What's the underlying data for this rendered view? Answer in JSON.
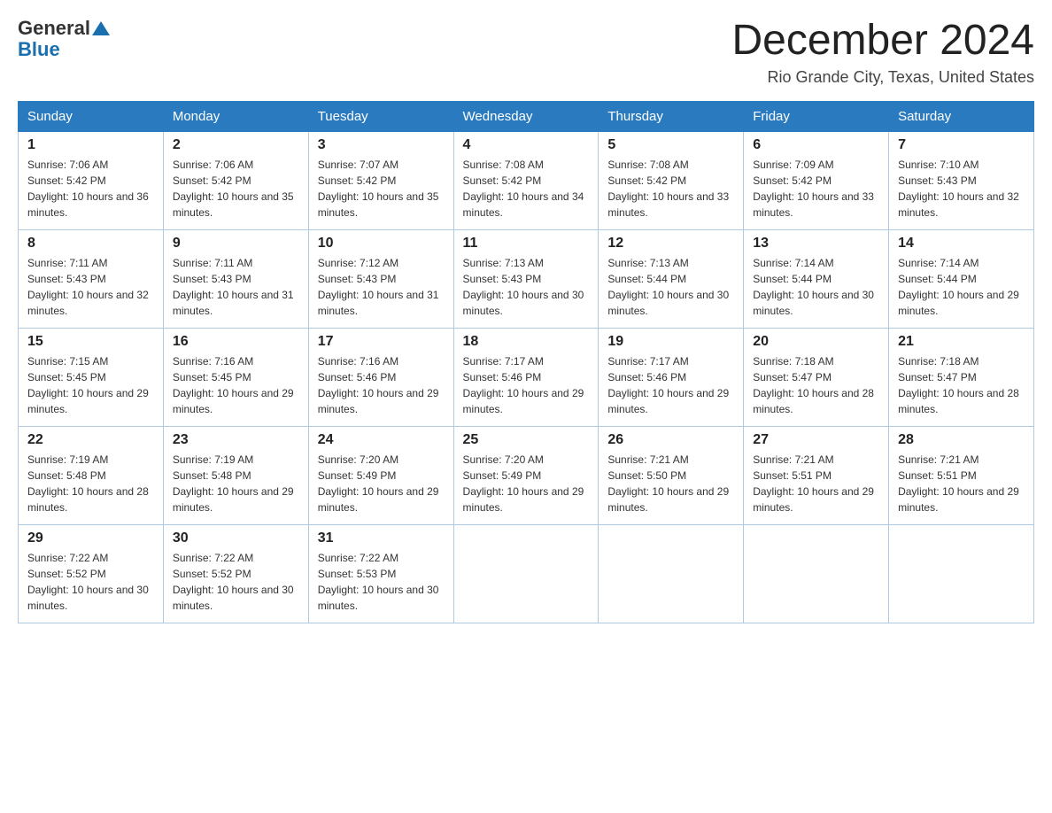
{
  "logo": {
    "general": "General",
    "blue": "Blue"
  },
  "title": "December 2024",
  "location": "Rio Grande City, Texas, United States",
  "headers": [
    "Sunday",
    "Monday",
    "Tuesday",
    "Wednesday",
    "Thursday",
    "Friday",
    "Saturday"
  ],
  "weeks": [
    [
      {
        "day": "1",
        "sunrise": "7:06 AM",
        "sunset": "5:42 PM",
        "daylight": "10 hours and 36 minutes."
      },
      {
        "day": "2",
        "sunrise": "7:06 AM",
        "sunset": "5:42 PM",
        "daylight": "10 hours and 35 minutes."
      },
      {
        "day": "3",
        "sunrise": "7:07 AM",
        "sunset": "5:42 PM",
        "daylight": "10 hours and 35 minutes."
      },
      {
        "day": "4",
        "sunrise": "7:08 AM",
        "sunset": "5:42 PM",
        "daylight": "10 hours and 34 minutes."
      },
      {
        "day": "5",
        "sunrise": "7:08 AM",
        "sunset": "5:42 PM",
        "daylight": "10 hours and 33 minutes."
      },
      {
        "day": "6",
        "sunrise": "7:09 AM",
        "sunset": "5:42 PM",
        "daylight": "10 hours and 33 minutes."
      },
      {
        "day": "7",
        "sunrise": "7:10 AM",
        "sunset": "5:43 PM",
        "daylight": "10 hours and 32 minutes."
      }
    ],
    [
      {
        "day": "8",
        "sunrise": "7:11 AM",
        "sunset": "5:43 PM",
        "daylight": "10 hours and 32 minutes."
      },
      {
        "day": "9",
        "sunrise": "7:11 AM",
        "sunset": "5:43 PM",
        "daylight": "10 hours and 31 minutes."
      },
      {
        "day": "10",
        "sunrise": "7:12 AM",
        "sunset": "5:43 PM",
        "daylight": "10 hours and 31 minutes."
      },
      {
        "day": "11",
        "sunrise": "7:13 AM",
        "sunset": "5:43 PM",
        "daylight": "10 hours and 30 minutes."
      },
      {
        "day": "12",
        "sunrise": "7:13 AM",
        "sunset": "5:44 PM",
        "daylight": "10 hours and 30 minutes."
      },
      {
        "day": "13",
        "sunrise": "7:14 AM",
        "sunset": "5:44 PM",
        "daylight": "10 hours and 30 minutes."
      },
      {
        "day": "14",
        "sunrise": "7:14 AM",
        "sunset": "5:44 PM",
        "daylight": "10 hours and 29 minutes."
      }
    ],
    [
      {
        "day": "15",
        "sunrise": "7:15 AM",
        "sunset": "5:45 PM",
        "daylight": "10 hours and 29 minutes."
      },
      {
        "day": "16",
        "sunrise": "7:16 AM",
        "sunset": "5:45 PM",
        "daylight": "10 hours and 29 minutes."
      },
      {
        "day": "17",
        "sunrise": "7:16 AM",
        "sunset": "5:46 PM",
        "daylight": "10 hours and 29 minutes."
      },
      {
        "day": "18",
        "sunrise": "7:17 AM",
        "sunset": "5:46 PM",
        "daylight": "10 hours and 29 minutes."
      },
      {
        "day": "19",
        "sunrise": "7:17 AM",
        "sunset": "5:46 PM",
        "daylight": "10 hours and 29 minutes."
      },
      {
        "day": "20",
        "sunrise": "7:18 AM",
        "sunset": "5:47 PM",
        "daylight": "10 hours and 28 minutes."
      },
      {
        "day": "21",
        "sunrise": "7:18 AM",
        "sunset": "5:47 PM",
        "daylight": "10 hours and 28 minutes."
      }
    ],
    [
      {
        "day": "22",
        "sunrise": "7:19 AM",
        "sunset": "5:48 PM",
        "daylight": "10 hours and 28 minutes."
      },
      {
        "day": "23",
        "sunrise": "7:19 AM",
        "sunset": "5:48 PM",
        "daylight": "10 hours and 29 minutes."
      },
      {
        "day": "24",
        "sunrise": "7:20 AM",
        "sunset": "5:49 PM",
        "daylight": "10 hours and 29 minutes."
      },
      {
        "day": "25",
        "sunrise": "7:20 AM",
        "sunset": "5:49 PM",
        "daylight": "10 hours and 29 minutes."
      },
      {
        "day": "26",
        "sunrise": "7:21 AM",
        "sunset": "5:50 PM",
        "daylight": "10 hours and 29 minutes."
      },
      {
        "day": "27",
        "sunrise": "7:21 AM",
        "sunset": "5:51 PM",
        "daylight": "10 hours and 29 minutes."
      },
      {
        "day": "28",
        "sunrise": "7:21 AM",
        "sunset": "5:51 PM",
        "daylight": "10 hours and 29 minutes."
      }
    ],
    [
      {
        "day": "29",
        "sunrise": "7:22 AM",
        "sunset": "5:52 PM",
        "daylight": "10 hours and 30 minutes."
      },
      {
        "day": "30",
        "sunrise": "7:22 AM",
        "sunset": "5:52 PM",
        "daylight": "10 hours and 30 minutes."
      },
      {
        "day": "31",
        "sunrise": "7:22 AM",
        "sunset": "5:53 PM",
        "daylight": "10 hours and 30 minutes."
      },
      null,
      null,
      null,
      null
    ]
  ]
}
